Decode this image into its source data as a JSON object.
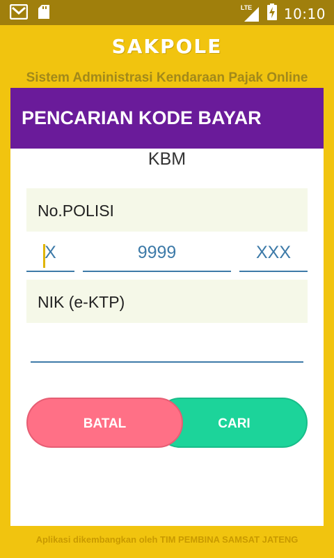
{
  "status_bar": {
    "time": "10:10",
    "network": "LTE",
    "icons": [
      "gmail-icon",
      "sd-card-icon",
      "signal-icon",
      "battery-charging-icon"
    ]
  },
  "app": {
    "brand": "SAKPOLE",
    "subtitle": "Sistem Administrasi Kendaraan Pajak Online"
  },
  "card": {
    "title": "PENCARIAN KODE BAYAR",
    "category": "KBM",
    "plate_label": "No.POLISI",
    "plate_prefix_placeholder": "X",
    "plate_number_placeholder": "9999",
    "plate_suffix_placeholder": "XXX",
    "nik_label": "NIK (e-KTP)",
    "nik_value": ""
  },
  "buttons": {
    "cancel": "BATAL",
    "search": "CARI"
  },
  "footer": "Aplikasi dikembangkan oleh TIM PEMBINA SAMSAT JATENG",
  "colors": {
    "background": "#f1c40f",
    "status_bar": "#a07f0c",
    "header": "#6a1b9a",
    "cancel_button": "#ff7086",
    "search_button": "#1cd49a",
    "input_accent": "#3d7aa8"
  }
}
